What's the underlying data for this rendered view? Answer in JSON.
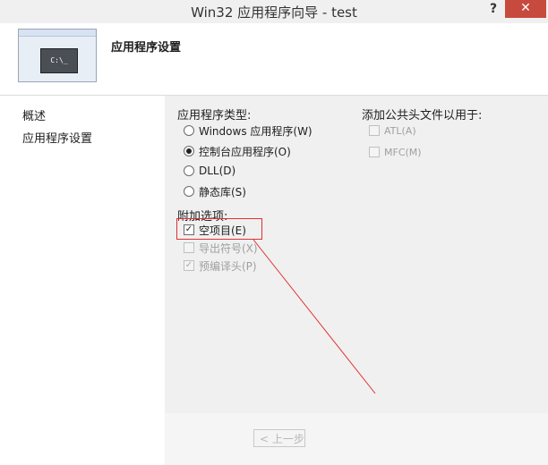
{
  "window": {
    "title": "Win32 应用程序向导 - test",
    "help_label": "?",
    "close_label": "✕"
  },
  "header": {
    "page_title": "应用程序设置",
    "thumb_text": "C:\\_"
  },
  "sidebar": {
    "items": [
      {
        "label": "概述"
      },
      {
        "label": "应用程序设置"
      }
    ]
  },
  "app_type": {
    "label": "应用程序类型:",
    "options": [
      {
        "label": "Windows 应用程序(W)",
        "selected": false
      },
      {
        "label": "控制台应用程序(O)",
        "selected": true
      },
      {
        "label": "DLL(D)",
        "selected": false
      },
      {
        "label": "静态库(S)",
        "selected": false
      }
    ]
  },
  "extra": {
    "label": "附加选项:",
    "options": [
      {
        "label": "空项目(E)",
        "checked": true,
        "enabled": true
      },
      {
        "label": "导出符号(X)",
        "checked": false,
        "enabled": false
      },
      {
        "label": "预编译头(P)",
        "checked": true,
        "enabled": false
      }
    ]
  },
  "common_headers": {
    "label": "添加公共头文件以用于:",
    "options": [
      {
        "label": "ATL(A)",
        "checked": false,
        "enabled": false
      },
      {
        "label": "MFC(M)",
        "checked": false,
        "enabled": false
      }
    ]
  },
  "footer": {
    "back_label": "< 上一步"
  },
  "colors": {
    "highlight": "#e03030",
    "close": "#c74a3f"
  }
}
